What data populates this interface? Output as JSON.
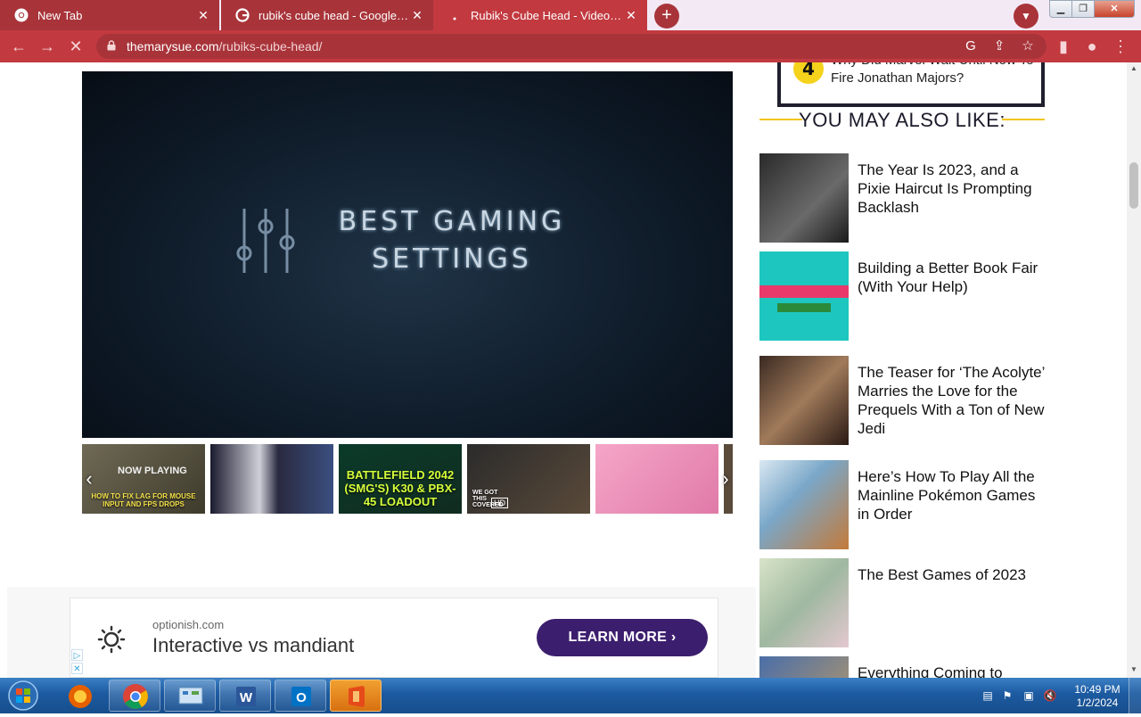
{
  "browser": {
    "tabs": [
      {
        "title": "New Tab",
        "favicon": "chrome-icon"
      },
      {
        "title": "rubik's cube head - Google Search",
        "favicon": "google-icon"
      },
      {
        "title": "Rubik's Cube Head - Video | The Mary Sue",
        "favicon": "loading-icon"
      }
    ],
    "url_host": "themarysue.com",
    "url_path": "/rubiks-cube-head/",
    "accent": "#c23a40"
  },
  "video": {
    "title_line1": "BEST GAMING",
    "title_line2": "SETTINGS"
  },
  "carousel": {
    "items": [
      {
        "caption": "HOW TO FIX LAG FOR MOUSE INPUT AND FPS DROPS",
        "badge": "NOW PLAYING"
      },
      {
        "caption": ""
      },
      {
        "caption": "BATTLEFIELD 2042 (SMG'S) K30 & PBX-45 LOADOUT"
      },
      {
        "caption": "WE GOT THIS COVERED",
        "badge": "HD"
      },
      {
        "caption": ""
      }
    ]
  },
  "ad": {
    "domain": "optionish.com",
    "headline": "Interactive vs mandiant",
    "button": "LEARN MORE"
  },
  "sidebar": {
    "popular": {
      "number": "4",
      "title": "Why Did Marvel Wait Until Now To Fire Jonathan Majors?"
    },
    "heading": "YOU MAY ALSO LIKE:",
    "related": [
      {
        "title": "The Year Is 2023, and a Pixie Haircut Is Prompting Backlash"
      },
      {
        "title": "Building a Better Book Fair (With Your Help)"
      },
      {
        "title": "The Teaser for ‘The Acolyte’ Marries the Love for the Prequels With a Ton of New Jedi"
      },
      {
        "title": "Here’s How To Play All the Mainline Pokémon Games in Order"
      },
      {
        "title": "The Best Games of 2023"
      },
      {
        "title": "Everything Coming to"
      }
    ]
  },
  "taskbar": {
    "apps": [
      "firefox-icon",
      "chrome-icon",
      "control-panel-icon",
      "word-icon",
      "outlook-icon",
      "office-icon"
    ],
    "time": "10:49 PM",
    "date": "1/2/2024"
  }
}
